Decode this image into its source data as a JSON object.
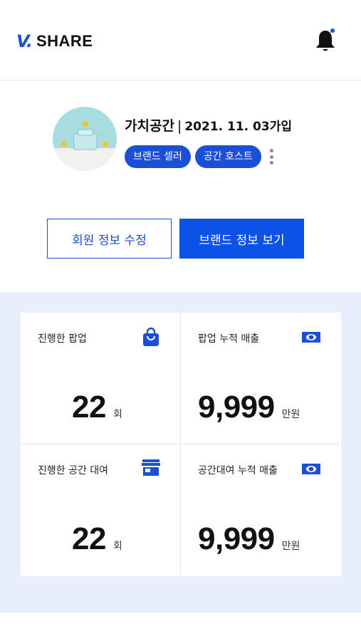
{
  "header": {
    "logo_mark": "V.",
    "logo_text": "SHARE",
    "notification_icon": "bell-icon"
  },
  "profile": {
    "name": "가치공간",
    "separator": "|",
    "join_date": "2021. 11. 03가입",
    "badges": [
      "브랜드 셀러",
      "공간 호스트"
    ],
    "more_icon": "kebab-menu-icon",
    "edit_button": "회원 정보 수정",
    "brand_button": "브랜드 정보 보기"
  },
  "stats": [
    {
      "label": "진행한 팝업",
      "value": "22",
      "unit": "회",
      "icon": "shopping-bag-icon"
    },
    {
      "label": "팝업 누적 매출",
      "value": "9,999",
      "unit": "만원",
      "icon": "cash-icon"
    },
    {
      "label": "진행한 공간 대여",
      "value": "22",
      "unit": "회",
      "icon": "store-icon"
    },
    {
      "label": "공간대여 누적 매출",
      "value": "9,999",
      "unit": "만원",
      "icon": "cash-icon"
    }
  ],
  "colors": {
    "accent": "#1a4fd6",
    "primary_button": "#0b52e6",
    "stats_background": "#e8eefc"
  }
}
